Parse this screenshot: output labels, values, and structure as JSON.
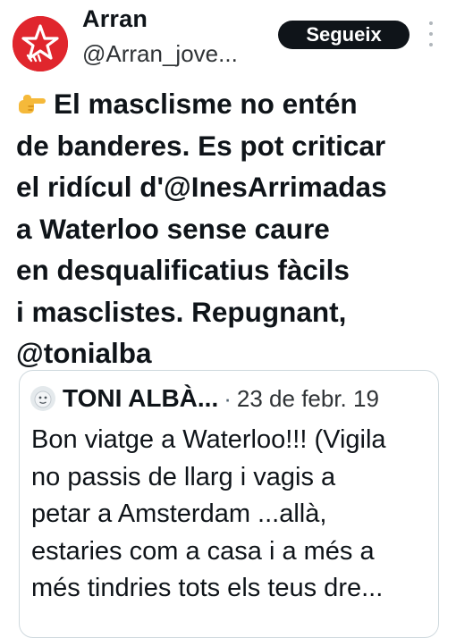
{
  "author": {
    "display_name": "Arran",
    "handle": "@Arran_jove...",
    "avatar_color": "#e0262d"
  },
  "follow_label": "Segueix",
  "more_icon": "more-vertical-icon",
  "tweet": {
    "icon": "backhand-index-pointing-right-icon",
    "lines": [
      "El masclisme no entén",
      "de banderes. Es pot criticar",
      "el ridícul d'@InesArrimadas",
      "a Waterloo sense caure",
      "en desqualificatius fàcils",
      "i masclistes. Repugnant,",
      "@tonialba"
    ]
  },
  "quoted": {
    "author_name": "TONI ALBÀ...",
    "separator": "·",
    "date": "23 de febr. 19",
    "lines": [
      "Bon viatge a Waterloo!!! (Vigila",
      "no passis de llarg i vagis a",
      "petar a Amsterdam ...allà,",
      "estaries com a casa i a més a",
      "més tindries tots els teus dre..."
    ]
  },
  "colors": {
    "text": "#0f1419",
    "secondary": "#536471",
    "border": "#cfd9de",
    "button_bg": "#0f1419",
    "button_text": "#ffffff"
  }
}
